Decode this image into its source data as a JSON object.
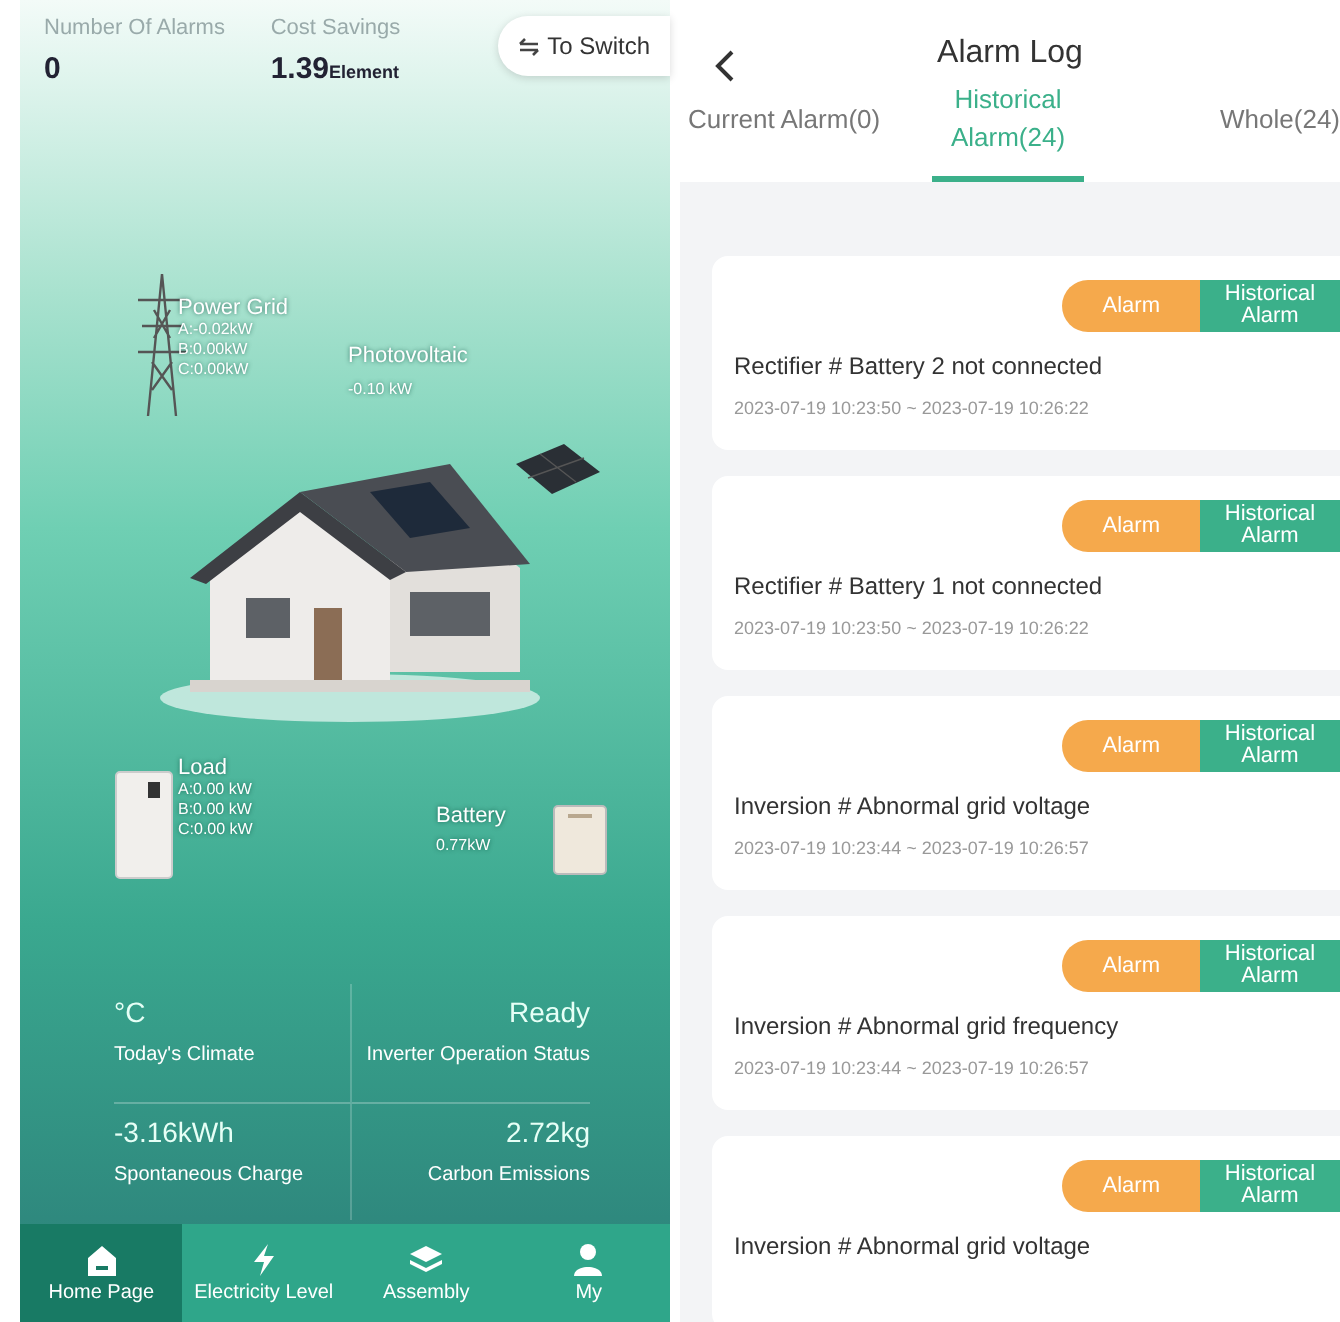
{
  "home": {
    "alarms": {
      "label": "Number Of Alarms",
      "value": "0"
    },
    "savings": {
      "label": "Cost Savings",
      "value": "1.39",
      "unit": "Element"
    },
    "switch_button": {
      "label": "To Switch"
    },
    "grid": {
      "label": "Power Grid",
      "lines": [
        "A:-0.02kW",
        "B:0.00kW",
        "C:0.00kW"
      ]
    },
    "photovoltaic": {
      "label": "Photovoltaic",
      "value": "-0.10 kW"
    },
    "load": {
      "label": "Load",
      "lines": [
        "A:0.00 kW",
        "B:0.00 kW",
        "C:0.00 kW"
      ]
    },
    "battery": {
      "label": "Battery",
      "value": "0.77kW"
    },
    "metrics": [
      {
        "value": "°C",
        "label": "Today's Climate"
      },
      {
        "value": "Ready",
        "label": "Inverter Operation Status"
      },
      {
        "value": "-3.16kWh",
        "label": "Spontaneous Charge"
      },
      {
        "value": "2.72kg",
        "label": "Carbon Emissions"
      }
    ],
    "nav": [
      {
        "label": "Home Page",
        "kind": "home",
        "selected": true
      },
      {
        "label": "Electricity Level",
        "kind": "bolt",
        "selected": false
      },
      {
        "label": "Assembly",
        "kind": "layers",
        "selected": false
      },
      {
        "label": "My",
        "kind": "user",
        "selected": false
      }
    ]
  },
  "alarm_log": {
    "title": "Alarm Log",
    "tabs": [
      {
        "label": "Current Alarm(0)",
        "selected": false
      },
      {
        "label": "Historical Alarm(24)",
        "selected": true
      },
      {
        "label": "Whole(24)",
        "selected": false
      }
    ],
    "alarms": [
      {
        "level": "Alarm",
        "status": "Historical Alarm",
        "message": "Rectifier # Battery 2 not connected",
        "time": "2023-07-19 10:23:50 ~ 2023-07-19 10:26:22"
      },
      {
        "level": "Alarm",
        "status": "Historical Alarm",
        "message": "Rectifier # Battery 1 not connected",
        "time": "2023-07-19 10:23:50 ~ 2023-07-19 10:26:22"
      },
      {
        "level": "Alarm",
        "status": "Historical Alarm",
        "message": "Inversion # Abnormal grid voltage",
        "time": "2023-07-19 10:23:44 ~ 2023-07-19 10:26:57"
      },
      {
        "level": "Alarm",
        "status": "Historical Alarm",
        "message": "Inversion # Abnormal grid frequency",
        "time": "2023-07-19 10:23:44 ~ 2023-07-19 10:26:57"
      },
      {
        "level": "Alarm",
        "status": "Historical Alarm",
        "message": "Inversion # Abnormal grid voltage"
      }
    ]
  }
}
